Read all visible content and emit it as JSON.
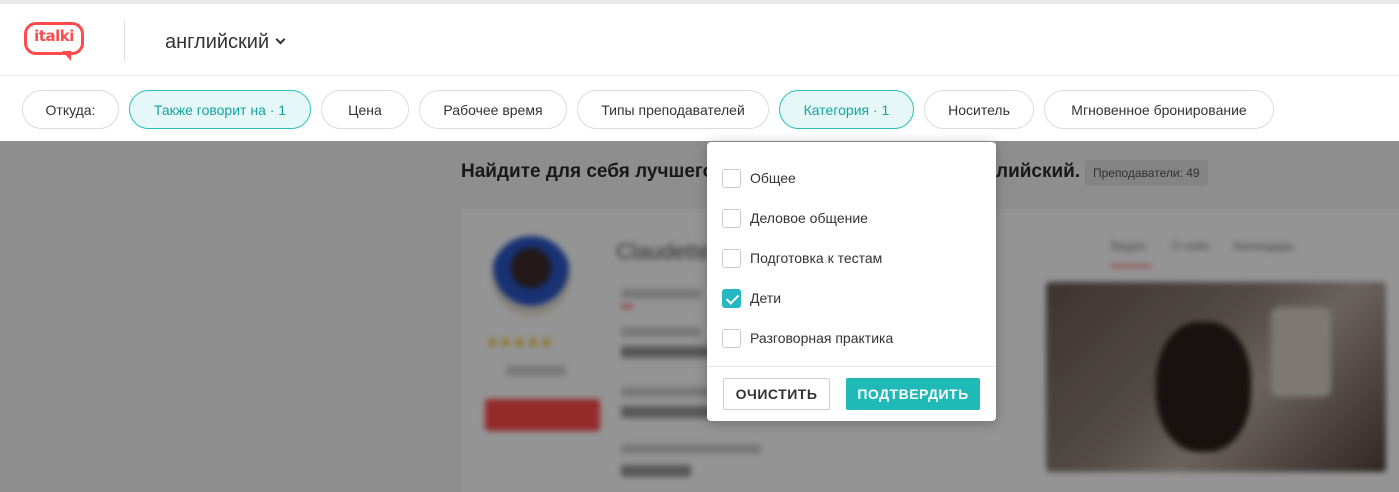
{
  "header": {
    "logo_text": "italki",
    "language": "английский"
  },
  "filters": [
    {
      "label": "Откуда:",
      "active": false
    },
    {
      "label": "Также говорит на · 1",
      "active": true
    },
    {
      "label": "Цена",
      "active": false
    },
    {
      "label": "Рабочее время",
      "active": false
    },
    {
      "label": "Типы преподавателей",
      "active": false
    },
    {
      "label": "Категория · 1",
      "active": true
    },
    {
      "label": "Носитель",
      "active": false
    },
    {
      "label": "Мгновенное бронирование",
      "active": false
    }
  ],
  "main": {
    "title_left": "Найдите для себя лучшего",
    "title_right": "лийский.",
    "teacher_count": "Преподаватели: 49",
    "card": {
      "name": "Claudette",
      "tabs": [
        "Видео",
        "О себе",
        "Календарь"
      ]
    }
  },
  "category_dropdown": {
    "options": [
      {
        "label": "Общее",
        "checked": false
      },
      {
        "label": "Деловое общение",
        "checked": false
      },
      {
        "label": "Подготовка к тестам",
        "checked": false
      },
      {
        "label": "Дети",
        "checked": true
      },
      {
        "label": "Разговорная практика",
        "checked": false
      }
    ],
    "clear_label": "ОЧИСТИТЬ",
    "confirm_label": "ПОДТВЕРДИТЬ"
  },
  "colors": {
    "brand": "#ff4b4b",
    "accent": "#1fbab8"
  }
}
